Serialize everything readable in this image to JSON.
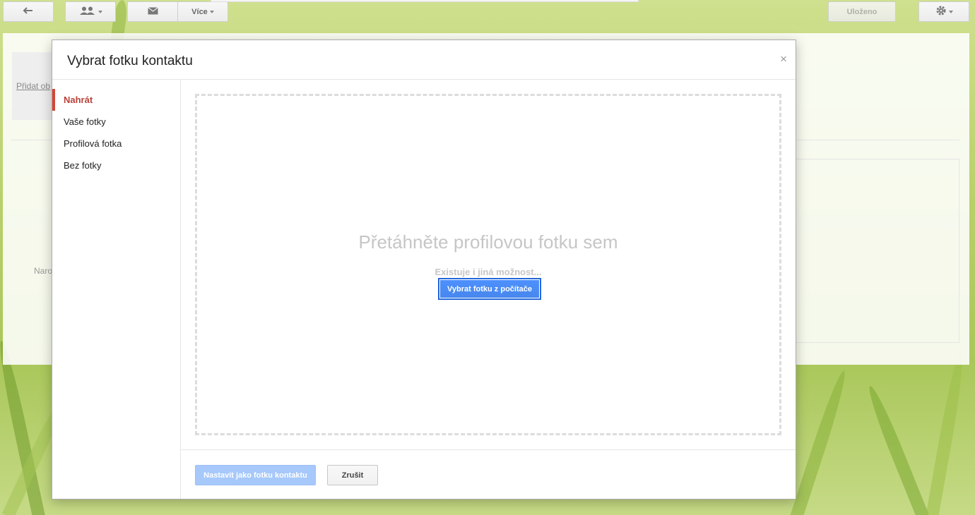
{
  "colors": {
    "accent_red": "#d14836",
    "primary_blue": "#4d90fe",
    "disabled_blue": "#a6c8fa"
  },
  "toolbar": {
    "back_icon": "back-arrow-icon",
    "people_icon": "people-icon",
    "mail_icon": "mail-icon",
    "more_label": "Více",
    "saved_label": "Uloženo",
    "settings_icon": "gear-icon"
  },
  "underlying": {
    "add_photo_link": "Přidat ob",
    "partial_label": "Naro"
  },
  "dialog": {
    "title": "Vybrat fotku kontaktu",
    "close_glyph": "×",
    "nav": [
      {
        "label": "Nahrát",
        "active": true
      },
      {
        "label": "Vaše fotky",
        "active": false
      },
      {
        "label": "Profilová fotka",
        "active": false
      },
      {
        "label": "Bez fotky",
        "active": false
      }
    ],
    "dropzone": {
      "title": "Přetáhněte profilovou fotku sem",
      "alt_text": "Existuje i jiná možnost...",
      "pick_button": "Vybrat fotku z počítače"
    },
    "footer": {
      "set_button": "Nastavit jako fotku kontaktu",
      "cancel_button": "Zrušit"
    }
  }
}
